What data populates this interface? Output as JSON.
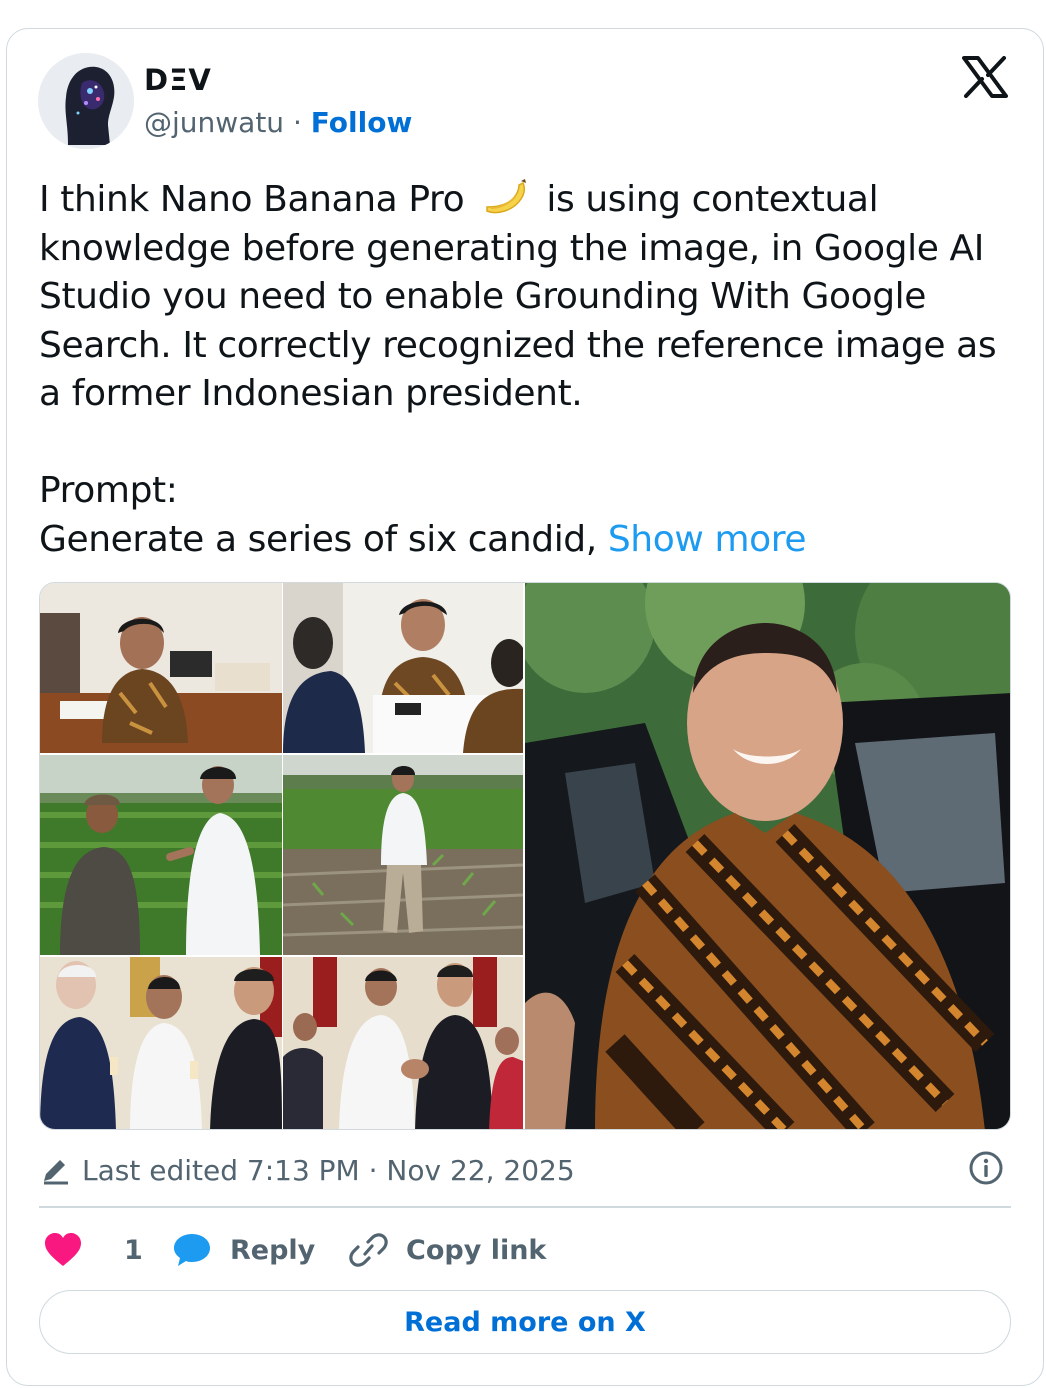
{
  "author": {
    "name": "DΞV",
    "handle": "@junwatu",
    "separator": "·",
    "follow_label": "Follow"
  },
  "tweet": {
    "line1_before": "I think Nano Banana Pro",
    "line1_after": "is using contextual knowledge before generating the image, in Google AI Studio you need to enable Grounding With Google Search. It correctly recognized the reference image as a former Indonesian president.",
    "prompt_label": "Prompt:",
    "prompt_text": "Generate a series of six candid,",
    "show_more": "Show more"
  },
  "meta": {
    "edited_label": "Last edited 7:13 PM · Nov 22, 2025"
  },
  "actions": {
    "like_count": "1",
    "reply_label": "Reply",
    "copy_label": "Copy link"
  },
  "read_more_label": "Read more on X",
  "colors": {
    "accent": "#006fd6",
    "link": "#1d9bf0",
    "heart": "#f91880",
    "muted": "#536471",
    "border": "#cfd9de"
  },
  "icons": [
    "x-logo-icon",
    "banana-icon",
    "pencil-icon",
    "info-icon",
    "heart-icon",
    "reply-bubble-icon",
    "link-icon"
  ]
}
